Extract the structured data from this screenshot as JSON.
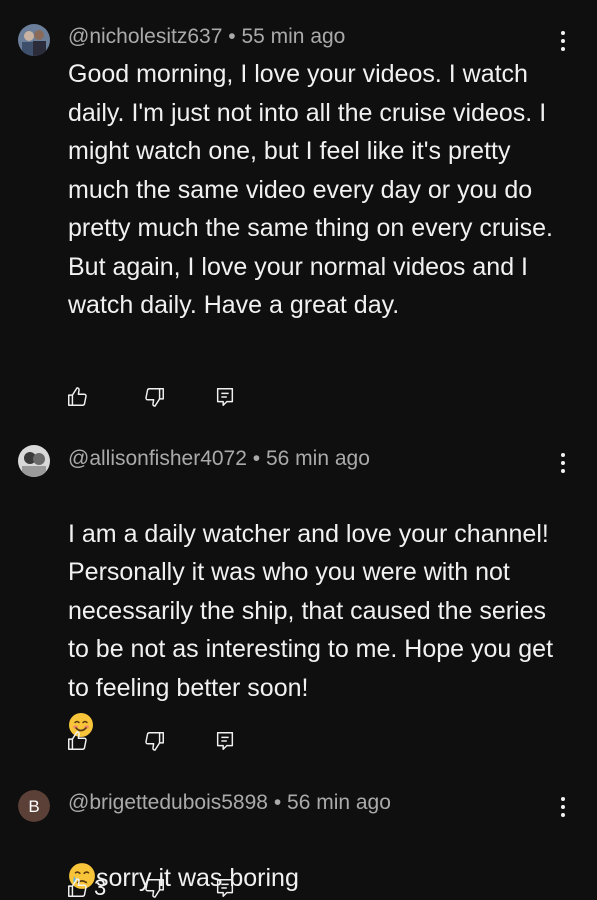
{
  "comments": [
    {
      "handle": "@nicholesitz637",
      "separator": "•",
      "time": "55 min ago",
      "text": "Good morning, I love your videos. I watch daily. I'm just not into all the cruise videos. I might watch one, but I feel like it's pretty much the same video every day or you do pretty much the same thing on every cruise. But again, I love your normal videos and I watch daily. Have a great day.",
      "avatar": "photo",
      "like_count": ""
    },
    {
      "handle": "@allisonfisher4072",
      "separator": "•",
      "time": "56 min ago",
      "text": "I am a daily watcher and love your channel! Personally it was who you were with not necessarily the ship, that caused the series to be not as interesting to me. Hope you get to feeling better soon!",
      "emoji": "smiling-face-emoji",
      "avatar": "photo",
      "like_count": ""
    },
    {
      "handle": "@brigettedubois5898",
      "separator": "•",
      "time": "56 min ago",
      "text": "sorry it was boring",
      "emoji_before": "crying-face-emoji",
      "avatar_letter": "B",
      "avatar_color": "#5b4037",
      "like_count": "3"
    }
  ],
  "icons": {
    "like": "thumbs-up-icon",
    "dislike": "thumbs-down-icon",
    "reply": "reply-icon",
    "more": "more-vert-icon"
  }
}
